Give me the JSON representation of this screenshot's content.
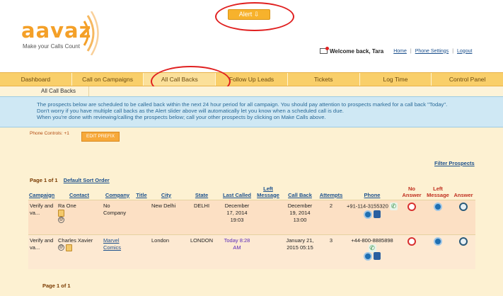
{
  "brand": {
    "name": "aavaz",
    "tagline": "Make your Calls Count"
  },
  "alert": {
    "label": "Alert ⇩"
  },
  "user": {
    "welcome": "Welcome back, Tara",
    "links": [
      "Home",
      "Phone Settings",
      "Logout"
    ]
  },
  "nav": {
    "items": [
      "Dashboard",
      "Call on Campaigns",
      "All Call Backs",
      "Follow Up Leads",
      "Tickets",
      "Log Time",
      "Control Panel"
    ],
    "active": "All Call Backs"
  },
  "subnav": {
    "item": "All Call Backs"
  },
  "info": {
    "line1": "The prospects below are scheduled to be called back within the next 24 hour period for all campaign. You should pay attention to prospects marked for a call back \"Today\".",
    "line2": "Don't worry if you have multiple call backs as the Alert slider above will automatically let you know when a scheduled call is due.",
    "line3": "When you're done with reviewing/calling the prospects below; call your other prospects by clicking on Make Calls above."
  },
  "controls": {
    "phone_controls": "Phone Controls: +1",
    "edit_prefix": "EDIT PREFIX",
    "filter": "Filter Prospects"
  },
  "paging": {
    "top": "Page 1 of 1",
    "sort": "Default Sort Order",
    "bottom": "Page 1 of 1"
  },
  "table": {
    "headers": [
      "Campaign",
      "Contact",
      "Company",
      "Title",
      "City",
      "State",
      "Last Called",
      "Left Message",
      "Call Back",
      "Attempts",
      "Phone",
      "No Answer",
      "Left Message",
      "Answer"
    ],
    "rows": [
      {
        "campaign": "Verify and va...",
        "contact": "Ra One",
        "company": "No Company",
        "title": "",
        "city": "New Delhi",
        "state": "DELHI",
        "last_called": "December 17, 2014 19:03",
        "left_message": "",
        "call_back": "December 19, 2014 13:00",
        "attempts": "2",
        "phone": "+91-114-3155320"
      },
      {
        "campaign": "Verify and va...",
        "contact": "Charles Xavier",
        "company": "Marvel Comics",
        "title": "",
        "city": "London",
        "state": "LONDON",
        "last_called": "Today 8:28 AM",
        "left_message": "",
        "call_back": "January 21, 2015 05:15",
        "attempts": "3",
        "phone": "+44-800-8885898"
      }
    ]
  },
  "colors": {
    "accent": "#f7b22c",
    "nav_bg": "#f9cf6a",
    "info_bg": "#cfe8f4",
    "link": "#1a4f8c",
    "highlight": "#e02020"
  }
}
